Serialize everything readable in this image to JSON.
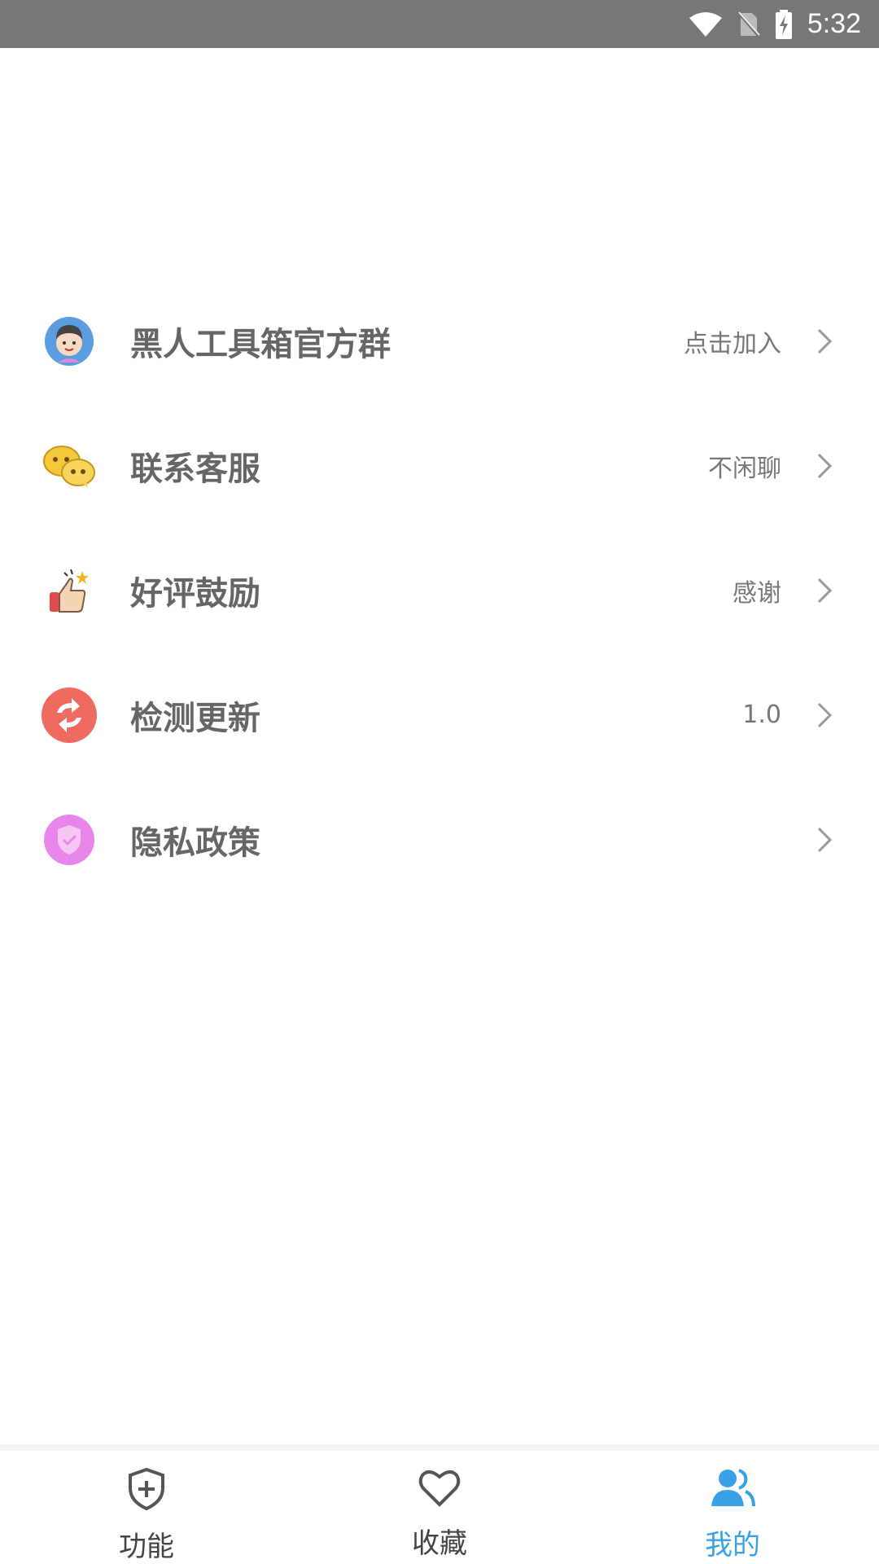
{
  "status_bar": {
    "time": "5:32",
    "icons": [
      "wifi-icon",
      "no-sim-icon",
      "battery-charging-icon"
    ]
  },
  "menu": {
    "items": [
      {
        "icon": "avatar-icon",
        "title": "黑人工具箱官方群",
        "value": "点击加入"
      },
      {
        "icon": "wechat-icon",
        "title": "联系客服",
        "value": "不闲聊"
      },
      {
        "icon": "thumbs-up-icon",
        "title": "好评鼓励",
        "value": "感谢"
      },
      {
        "icon": "refresh-icon",
        "title": "检测更新",
        "value": "1.0"
      },
      {
        "icon": "shield-check-icon",
        "title": "隐私政策",
        "value": ""
      }
    ]
  },
  "bottom_nav": {
    "items": [
      {
        "icon": "shield-plus-icon",
        "label": "功能"
      },
      {
        "icon": "heart-icon",
        "label": "收藏"
      },
      {
        "icon": "users-icon",
        "label": "我的",
        "active": true
      }
    ],
    "active_color": "#3aa0e8"
  }
}
